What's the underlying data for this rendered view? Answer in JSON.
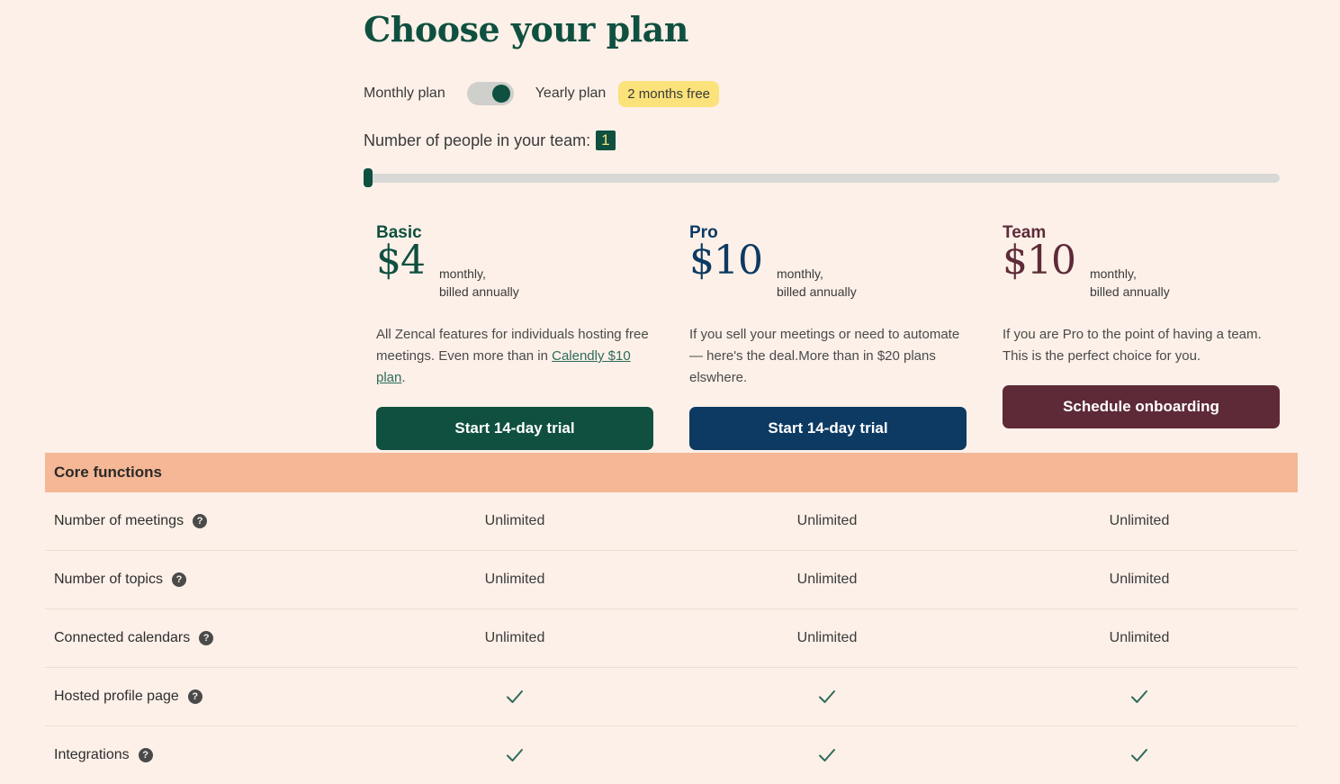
{
  "title": "Choose your plan",
  "billing": {
    "monthly_label": "Monthly plan",
    "yearly_label": "Yearly plan",
    "yearly_selected": true,
    "badge": "2 months free"
  },
  "team": {
    "label": "Number of people in your team:",
    "count": "1",
    "min": 1,
    "max": 100,
    "value": 1
  },
  "plans": [
    {
      "name": "Basic",
      "price": "$4",
      "note_line1": "monthly,",
      "note_line2": "billed annually",
      "desc_text": "All Zencal features for individuals hosting free meetings. Even more than in ",
      "desc_link": "Calendly $10 plan",
      "desc_after": ".",
      "button": "Start 14-day trial",
      "color": "#0f5040"
    },
    {
      "name": "Pro",
      "price": "$10",
      "note_line1": "monthly,",
      "note_line2": "billed annually",
      "desc_text": "If you sell your meetings or need to automate — here's the deal.More than in $20 plans elswhere.",
      "button": "Start 14-day trial",
      "color": "#0c3a63"
    },
    {
      "name": "Team",
      "price": "$10",
      "note_line1": "monthly,",
      "note_line2": "billed annually",
      "desc_text": "If you are Pro to the point of having a team. This is the perfect choice for you.",
      "button": "Schedule onboarding",
      "color": "#5e2a38"
    }
  ],
  "section": {
    "title": "Core functions",
    "color": "#f5b795"
  },
  "features": [
    {
      "label": "Number of meetings",
      "values": [
        "Unlimited",
        "Unlimited",
        "Unlimited"
      ]
    },
    {
      "label": "Number of topics",
      "values": [
        "Unlimited",
        "Unlimited",
        "Unlimited"
      ]
    },
    {
      "label": "Connected calendars",
      "values": [
        "Unlimited",
        "Unlimited",
        "Unlimited"
      ]
    },
    {
      "label": "Hosted profile page",
      "values": [
        "check",
        "check",
        "check"
      ]
    },
    {
      "label": "Integrations",
      "values": [
        "check",
        "check",
        "check"
      ]
    }
  ],
  "help_icon": "question-mark-icon",
  "check_icon": "check-icon",
  "colors": {
    "background": "#fcf0e8",
    "brand_green": "#0f5040",
    "badge_yellow": "#fbe27a"
  }
}
